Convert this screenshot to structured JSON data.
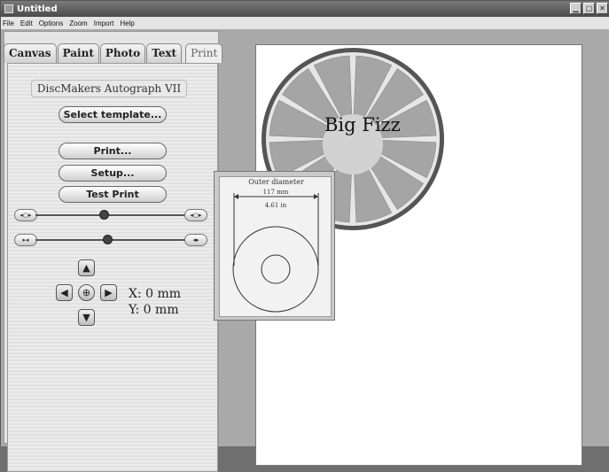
{
  "window": {
    "title": "Untitled",
    "buttons": [
      "▁",
      "▢",
      "✕"
    ]
  },
  "menu": [
    "File",
    "Edit",
    "Options",
    "Zoom",
    "Import",
    "Help"
  ],
  "tabs": [
    "Canvas",
    "Paint",
    "Photo",
    "Text",
    "Print"
  ],
  "active_tab": "Print",
  "print_panel": {
    "template_name": "DiscMakers Autograph VII",
    "select_template_label": "Select template...",
    "print_label": "Print...",
    "setup_label": "Setup...",
    "test_print_label": "Test Print",
    "slider1_level": 0.45,
    "slider2_level": 0.47,
    "x_readout": "X: 0 mm",
    "y_readout": "Y: 0 mm"
  },
  "popup": {
    "title": "Outer diameter",
    "mm_value": "117 mm",
    "in_value": "4.61 in"
  },
  "canvas": {
    "disc_text": "Big Fizz",
    "colors": {
      "rind": "#555555",
      "pulp": "#a5a5a5",
      "center": "#d2d2d2"
    }
  },
  "icons": {
    "up": "arrow-up-icon",
    "down": "arrow-down-icon",
    "left": "arrow-left-icon",
    "right": "arrow-right-icon",
    "center": "crosshair-icon"
  }
}
